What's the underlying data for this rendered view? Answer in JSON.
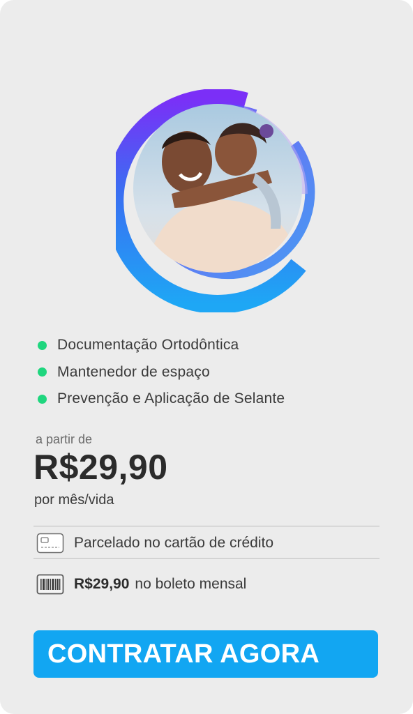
{
  "colors": {
    "card_background": "#ececec",
    "bullet": "#1fd67e",
    "cta_background": "#12a6f2",
    "cta_text": "#ffffff",
    "ring_gradient": [
      "#7b2ff7",
      "#1ea7f5"
    ]
  },
  "hero": {
    "image_alt": "Pai sorrindo carregando filha nas costas"
  },
  "features": [
    {
      "label": "Documentação Ortodôntica"
    },
    {
      "label": "Mantenedor de espaço"
    },
    {
      "label": "Prevenção e Aplicação de Selante"
    }
  ],
  "pricing": {
    "from_label": "a partir de",
    "price": "R$29,90",
    "period": "por mês/vida"
  },
  "payment_options": [
    {
      "icon": "credit-card-icon",
      "amount": "",
      "text": "Parcelado no cartão de crédito"
    },
    {
      "icon": "barcode-icon",
      "amount": "R$29,90",
      "text": "no boleto mensal"
    }
  ],
  "cta": {
    "label": "CONTRATAR AGORA"
  }
}
